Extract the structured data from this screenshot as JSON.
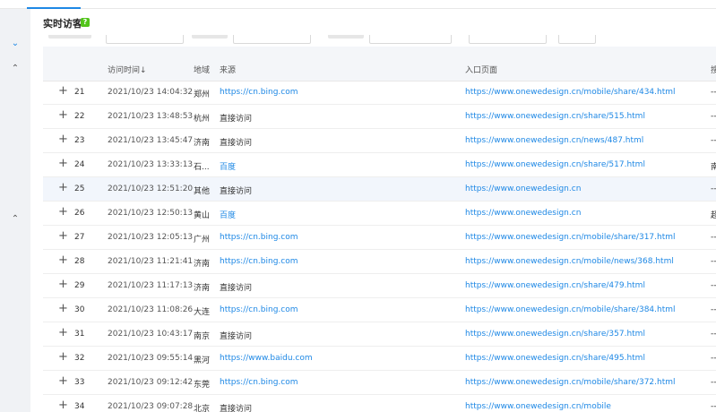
{
  "page": {
    "title": "实时访客",
    "help_badge": "?"
  },
  "table": {
    "headers": {
      "time": "访问时间",
      "sort_icon": "↓",
      "region": "地域",
      "source": "来源",
      "entry": "入口页面",
      "extra": "搜"
    },
    "rows": [
      {
        "n": "21",
        "time": "2021/10/23 14:04:32",
        "region": "郑州",
        "source": "https://cn.bing.com",
        "source_link": true,
        "entry": "https://www.onewedesign.cn/mobile/share/434.html",
        "extra": "--"
      },
      {
        "n": "22",
        "time": "2021/10/23 13:48:53",
        "region": "杭州",
        "source": "直接访问",
        "source_link": false,
        "entry": "https://www.onewedesign.cn/share/515.html",
        "extra": "--"
      },
      {
        "n": "23",
        "time": "2021/10/23 13:45:47",
        "region": "济南",
        "source": "直接访问",
        "source_link": false,
        "entry": "https://www.onewedesign.cn/news/487.html",
        "extra": "--"
      },
      {
        "n": "24",
        "time": "2021/10/23 13:33:13",
        "region": "石...",
        "source": "百度",
        "source_link": true,
        "entry": "https://www.onewedesign.cn/share/517.html",
        "extra": "南"
      },
      {
        "n": "25",
        "time": "2021/10/23 12:51:20",
        "region": "其他",
        "source": "直接访问",
        "source_link": false,
        "entry": "https://www.onewedesign.cn",
        "extra": "--"
      },
      {
        "n": "26",
        "time": "2021/10/23 12:50:13",
        "region": "黄山",
        "source": "百度",
        "source_link": true,
        "entry": "https://www.onewedesign.cn",
        "extra": "超"
      },
      {
        "n": "27",
        "time": "2021/10/23 12:05:13",
        "region": "广州",
        "source": "https://cn.bing.com",
        "source_link": true,
        "entry": "https://www.onewedesign.cn/mobile/share/317.html",
        "extra": "--"
      },
      {
        "n": "28",
        "time": "2021/10/23 11:21:41",
        "region": "济南",
        "source": "https://cn.bing.com",
        "source_link": true,
        "entry": "https://www.onewedesign.cn/mobile/news/368.html",
        "extra": "--"
      },
      {
        "n": "29",
        "time": "2021/10/23 11:17:13",
        "region": "济南",
        "source": "直接访问",
        "source_link": false,
        "entry": "https://www.onewedesign.cn/share/479.html",
        "extra": "--"
      },
      {
        "n": "30",
        "time": "2021/10/23 11:08:26",
        "region": "大连",
        "source": "https://cn.bing.com",
        "source_link": true,
        "entry": "https://www.onewedesign.cn/mobile/share/384.html",
        "extra": "--"
      },
      {
        "n": "31",
        "time": "2021/10/23 10:43:17",
        "region": "南京",
        "source": "直接访问",
        "source_link": false,
        "entry": "https://www.onewedesign.cn/share/357.html",
        "extra": "--"
      },
      {
        "n": "32",
        "time": "2021/10/23 09:55:14",
        "region": "黑河",
        "source": "https://www.baidu.com",
        "source_link": true,
        "entry": "https://www.onewedesign.cn/share/495.html",
        "extra": "--"
      },
      {
        "n": "33",
        "time": "2021/10/23 09:12:42",
        "region": "东莞",
        "source": "https://cn.bing.com",
        "source_link": true,
        "entry": "https://www.onewedesign.cn/mobile/share/372.html",
        "extra": "--"
      },
      {
        "n": "34",
        "time": "2021/10/23 09:07:28",
        "region": "北京",
        "source": "直接访问",
        "source_link": false,
        "entry": "https://www.onewedesign.cn/mobile",
        "extra": "--"
      }
    ],
    "highlighted_row": "25"
  },
  "rail": {
    "icons": [
      "chevron-down-icon",
      "chevron-up-icon",
      "chevron-up-icon"
    ]
  },
  "colors": {
    "link": "#1e88e5",
    "badge": "#52c41a",
    "row_highlight": "#f2f6fc",
    "tab_active": "#1e88e5"
  }
}
